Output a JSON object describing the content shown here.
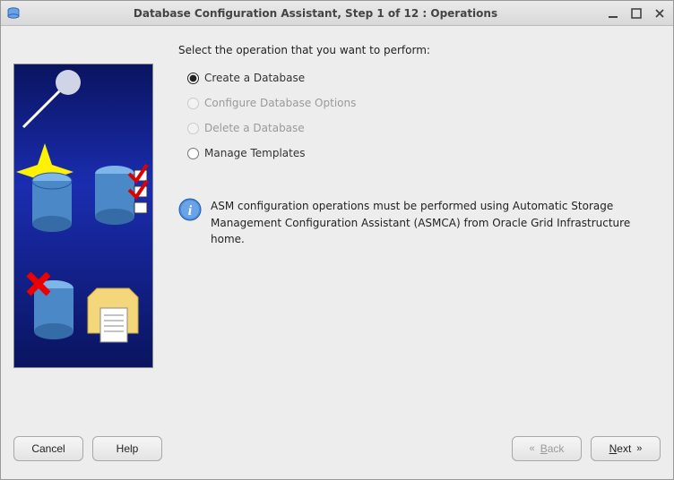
{
  "window": {
    "title": "Database Configuration Assistant, Step 1 of 12 : Operations"
  },
  "instruction": "Select the operation that you want to perform:",
  "options": {
    "create": {
      "label": "Create a Database",
      "selected": true,
      "enabled": true
    },
    "configure": {
      "label": "Configure Database Options",
      "selected": false,
      "enabled": false
    },
    "delete": {
      "label": "Delete a Database",
      "selected": false,
      "enabled": false
    },
    "templates": {
      "label": "Manage Templates",
      "selected": false,
      "enabled": true
    }
  },
  "info": {
    "text": "ASM configuration operations must be performed using Automatic Storage Management Configuration Assistant (ASMCA) from Oracle Grid Infrastructure home."
  },
  "buttons": {
    "cancel": "Cancel",
    "help": "Help",
    "back": "Back",
    "next": "Next"
  }
}
